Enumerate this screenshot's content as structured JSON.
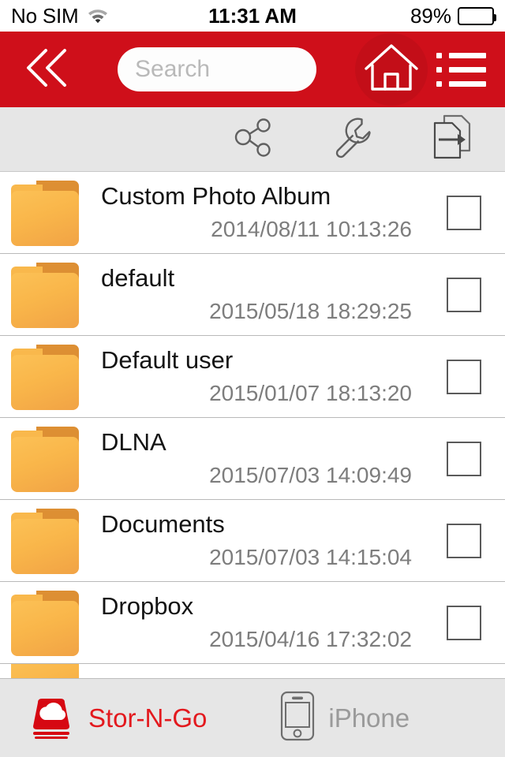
{
  "statusbar": {
    "carrier": "No SIM",
    "wifi_icon": "wifi-icon",
    "time": "11:31 AM",
    "battery_percent": "89%",
    "battery_icon": "battery-icon"
  },
  "navbar": {
    "back_icon": "double-chevron-left-icon",
    "search": {
      "value": "",
      "placeholder": "Search"
    },
    "home_icon": "home-icon",
    "menu_icon": "list-menu-icon",
    "background_color": "#cf0f1a"
  },
  "toolbar": {
    "buttons": [
      {
        "name": "share-button",
        "icon": "share-nodes-icon"
      },
      {
        "name": "tools-button",
        "icon": "wrench-icon"
      },
      {
        "name": "export-file-button",
        "icon": "file-export-icon"
      }
    ]
  },
  "file_list": {
    "icon": "folder-icon",
    "items": [
      {
        "name": "Custom Photo Album",
        "date": "2014/08/11 10:13:26",
        "checked": false
      },
      {
        "name": "default",
        "date": "2015/05/18 18:29:25",
        "checked": false
      },
      {
        "name": "Default user",
        "date": "2015/01/07 18:13:20",
        "checked": false
      },
      {
        "name": "DLNA",
        "date": "2015/07/03 14:09:49",
        "checked": false
      },
      {
        "name": "Documents",
        "date": "2015/07/03 14:15:04",
        "checked": false
      },
      {
        "name": "Dropbox",
        "date": "2015/04/16 17:32:02",
        "checked": false
      }
    ]
  },
  "tabbar": {
    "tabs": [
      {
        "label": "Stor-N-Go",
        "icon": "cloud-drive-icon",
        "active": true,
        "color": "#e3191e"
      },
      {
        "label": "iPhone",
        "icon": "iphone-icon",
        "active": false,
        "color": "#9a9a9a"
      }
    ]
  }
}
